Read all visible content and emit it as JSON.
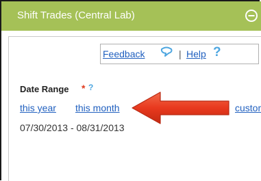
{
  "widget": {
    "title": "Shift Trades (Central Lab)",
    "collapse_icon": "minus-circle-icon"
  },
  "links": {
    "feedback_label": "Feedback",
    "feedback_icon": "speech-bubble-icon",
    "divider": "|",
    "help_label": "Help",
    "help_icon": "?"
  },
  "date_range": {
    "label": "Date Range",
    "required_mark": "*",
    "help_icon": "?",
    "options": [
      "this year",
      "this month",
      "custom"
    ],
    "value": "07/30/2013 - 08/31/2013"
  },
  "annotation": {
    "type": "red-arrow-icon",
    "color": "#e8391e"
  },
  "colors": {
    "header_bg": "#a5c157",
    "link": "#1f5fbf",
    "required": "#e03a1e",
    "help": "#4da6e0"
  }
}
